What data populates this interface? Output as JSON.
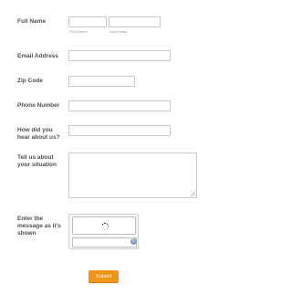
{
  "form": {
    "full_name": {
      "label": "Full Name",
      "first_sublabel": "First Name",
      "last_sublabel": "Last Name",
      "first_value": "",
      "last_value": ""
    },
    "email": {
      "label": "Email Address",
      "value": ""
    },
    "zip": {
      "label": "Zip Code",
      "value": ""
    },
    "phone": {
      "label": "Phone Number",
      "value": ""
    },
    "hear": {
      "label": "How did you hear about us?",
      "value": ""
    },
    "situation": {
      "label": "Tell us about your situation",
      "value": ""
    },
    "captcha": {
      "label": "Enter the message as it's shown",
      "value": "",
      "loading_icon": "spinner-icon",
      "refresh_icon": "refresh-icon"
    },
    "submit_label": "Submit"
  },
  "colors": {
    "submit": "#f09418",
    "label": "#4f4f4f",
    "border": "#c9c9c9"
  }
}
